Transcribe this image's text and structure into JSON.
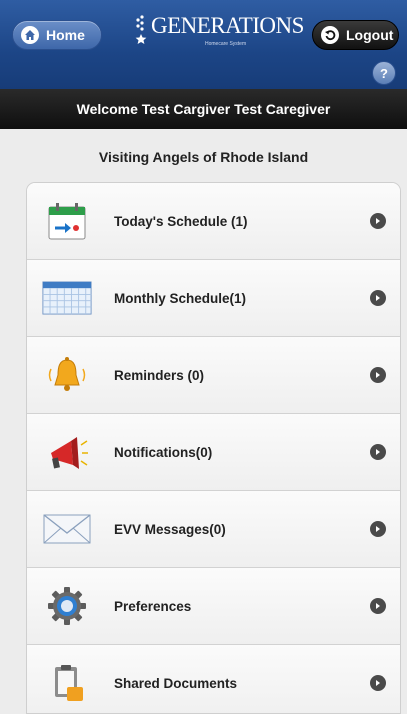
{
  "header": {
    "home_label": "Home",
    "logout_label": "Logout",
    "logo_text": "GENERATIONS",
    "logo_subtitle": "Homecare System",
    "help_label": "?"
  },
  "welcome": "Welcome Test Cargiver Test Caregiver",
  "agency": "Visiting Angels of Rhode Island",
  "menu": [
    {
      "label": "Today's Schedule (1)",
      "icon": "calendar-today-icon"
    },
    {
      "label": "Monthly Schedule(1)",
      "icon": "calendar-month-icon"
    },
    {
      "label": "Reminders (0)",
      "icon": "bell-icon"
    },
    {
      "label": "Notifications(0)",
      "icon": "megaphone-icon"
    },
    {
      "label": "EVV Messages(0)",
      "icon": "envelope-icon"
    },
    {
      "label": "Preferences",
      "icon": "gear-icon"
    },
    {
      "label": "Shared Documents",
      "icon": "clipboard-icon"
    }
  ],
  "colors": {
    "header_blue": "#1c4586",
    "welcome_bar": "#141414",
    "background": "#ececec"
  }
}
